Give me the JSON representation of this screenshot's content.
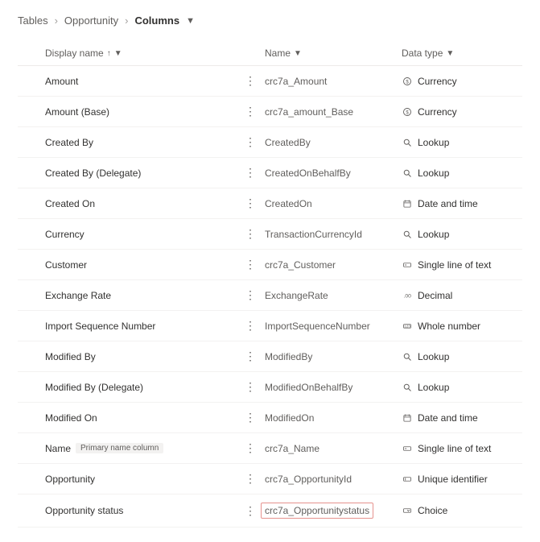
{
  "breadcrumb": {
    "root": "Tables",
    "mid": "Opportunity",
    "current": "Columns"
  },
  "headers": {
    "display": "Display name",
    "name": "Name",
    "datatype": "Data type"
  },
  "badge_primary": "Primary name column",
  "rows": [
    {
      "display": "Amount",
      "name": "crc7a_Amount",
      "type": "currency",
      "type_label": "Currency"
    },
    {
      "display": "Amount (Base)",
      "name": "crc7a_amount_Base",
      "type": "currency",
      "type_label": "Currency"
    },
    {
      "display": "Created By",
      "name": "CreatedBy",
      "type": "lookup",
      "type_label": "Lookup"
    },
    {
      "display": "Created By (Delegate)",
      "name": "CreatedOnBehalfBy",
      "type": "lookup",
      "type_label": "Lookup"
    },
    {
      "display": "Created On",
      "name": "CreatedOn",
      "type": "datetime",
      "type_label": "Date and time"
    },
    {
      "display": "Currency",
      "name": "TransactionCurrencyId",
      "type": "lookup",
      "type_label": "Lookup"
    },
    {
      "display": "Customer",
      "name": "crc7a_Customer",
      "type": "text",
      "type_label": "Single line of text"
    },
    {
      "display": "Exchange Rate",
      "name": "ExchangeRate",
      "type": "decimal",
      "type_label": "Decimal"
    },
    {
      "display": "Import Sequence Number",
      "name": "ImportSequenceNumber",
      "type": "whole",
      "type_label": "Whole number"
    },
    {
      "display": "Modified By",
      "name": "ModifiedBy",
      "type": "lookup",
      "type_label": "Lookup"
    },
    {
      "display": "Modified By (Delegate)",
      "name": "ModifiedOnBehalfBy",
      "type": "lookup",
      "type_label": "Lookup"
    },
    {
      "display": "Modified On",
      "name": "ModifiedOn",
      "type": "datetime",
      "type_label": "Date and time"
    },
    {
      "display": "Name",
      "name": "crc7a_Name",
      "type": "text",
      "type_label": "Single line of text",
      "primary": true
    },
    {
      "display": "Opportunity",
      "name": "crc7a_OpportunityId",
      "type": "unique",
      "type_label": "Unique identifier"
    },
    {
      "display": "Opportunity status",
      "name": "crc7a_Opportunitystatus",
      "type": "choice",
      "type_label": "Choice",
      "highlight": true
    }
  ]
}
